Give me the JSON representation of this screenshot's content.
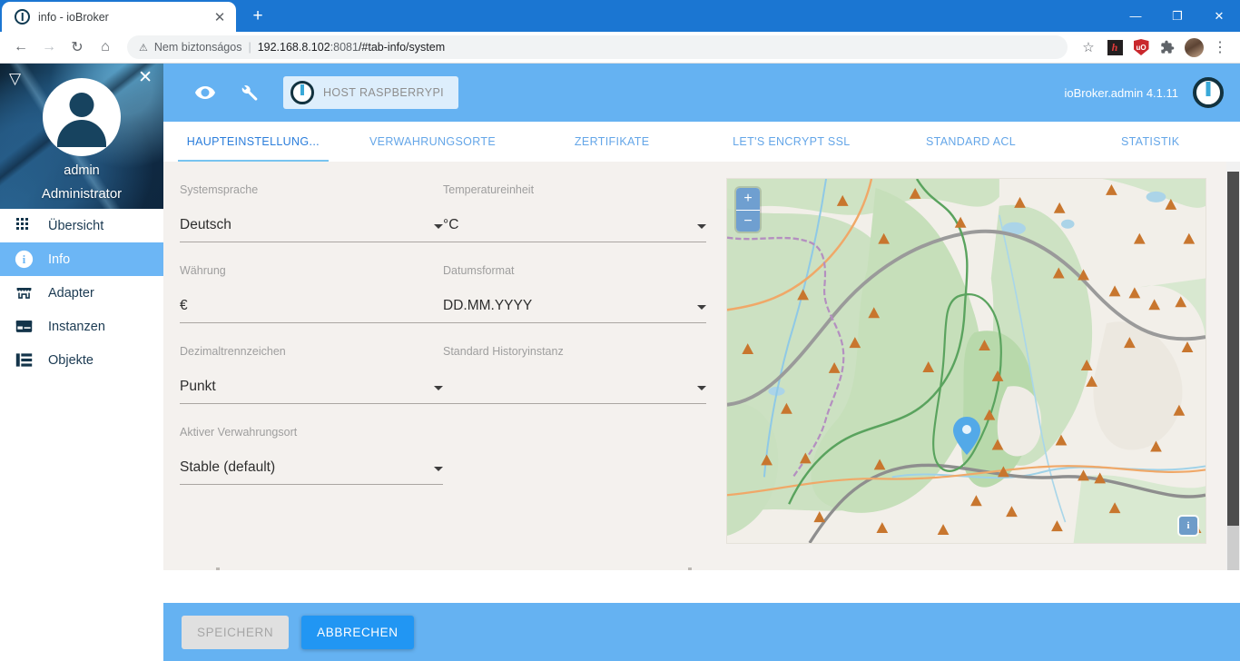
{
  "browser": {
    "tab": {
      "title": "info - ioBroker",
      "favicon": "iobroker-favicon",
      "close": "✕"
    },
    "newtab_label": "+",
    "window_controls": {
      "minimize": "—",
      "maximize": "❐",
      "close": "✕"
    },
    "nav": {
      "back": "←",
      "forward": "→",
      "reload": "↻",
      "home": "⌂"
    },
    "omnibox": {
      "security_icon": "warning-triangle-icon",
      "security_text": "Nem biztonságos",
      "separator": "|",
      "url_host": "192.168.8.102",
      "url_port": ":8081",
      "url_path": "/#tab-info/system",
      "url_full": "192.168.8.102:8081/#tab-info/system"
    },
    "actions": {
      "bookmark": "☆",
      "ext_h": "h",
      "ext_ublock": "uO",
      "ext_puzzle": "🧩",
      "menu": "⋮"
    }
  },
  "sidebar": {
    "collapse_icon": "▽",
    "close_icon": "✕",
    "user": "admin",
    "role": "Administrator",
    "items": [
      {
        "label": "Übersicht",
        "icon": "grid-icon",
        "active": false
      },
      {
        "label": "Info",
        "icon": "info-icon",
        "active": true
      },
      {
        "label": "Adapter",
        "icon": "store-icon",
        "active": false
      },
      {
        "label": "Instanzen",
        "icon": "instances-icon",
        "active": false
      },
      {
        "label": "Objekte",
        "icon": "list-icon",
        "active": false
      }
    ]
  },
  "appbar": {
    "eye_icon": "eye-icon",
    "wrench_icon": "wrench-icon",
    "host_chip_label": "HOST RASPBERRYPI",
    "version": "ioBroker.admin 4.1.11",
    "brand_logo": "iobroker-logo",
    "bg_color": "#65b2f2"
  },
  "tabs": [
    {
      "label": "HAUPTEINSTELLUNG...",
      "active": true
    },
    {
      "label": "VERWAHRUNGSORTE",
      "active": false
    },
    {
      "label": "ZERTIFIKATE",
      "active": false
    },
    {
      "label": "LET'S ENCRYPT SSL",
      "active": false
    },
    {
      "label": "STANDARD ACL",
      "active": false
    },
    {
      "label": "STATISTIK",
      "active": false
    }
  ],
  "form": {
    "left": [
      {
        "label": "Systemsprache",
        "value": "Deutsch",
        "type": "select"
      },
      {
        "label": "Währung",
        "value": "€",
        "type": "text"
      },
      {
        "label": "Dezimaltrennzeichen",
        "value": "Punkt",
        "type": "select"
      },
      {
        "label": "Aktiver Verwahrungsort",
        "value": "Stable (default)",
        "type": "select"
      }
    ],
    "right": [
      {
        "label": "Temperatureinheit",
        "value": "°C",
        "type": "select"
      },
      {
        "label": "Datumsformat",
        "value": "DD.MM.YYYY",
        "type": "select"
      },
      {
        "label": "Standard Historyinstanz",
        "value": "",
        "type": "select"
      }
    ]
  },
  "map": {
    "zoom_in": "+",
    "zoom_out": "−",
    "info_badge": "i",
    "marker": "location-pin"
  },
  "footer": {
    "save_label": "SPEICHERN",
    "save_disabled": true,
    "cancel_label": "ABBRECHEN",
    "primary_color": "#2196f3"
  }
}
